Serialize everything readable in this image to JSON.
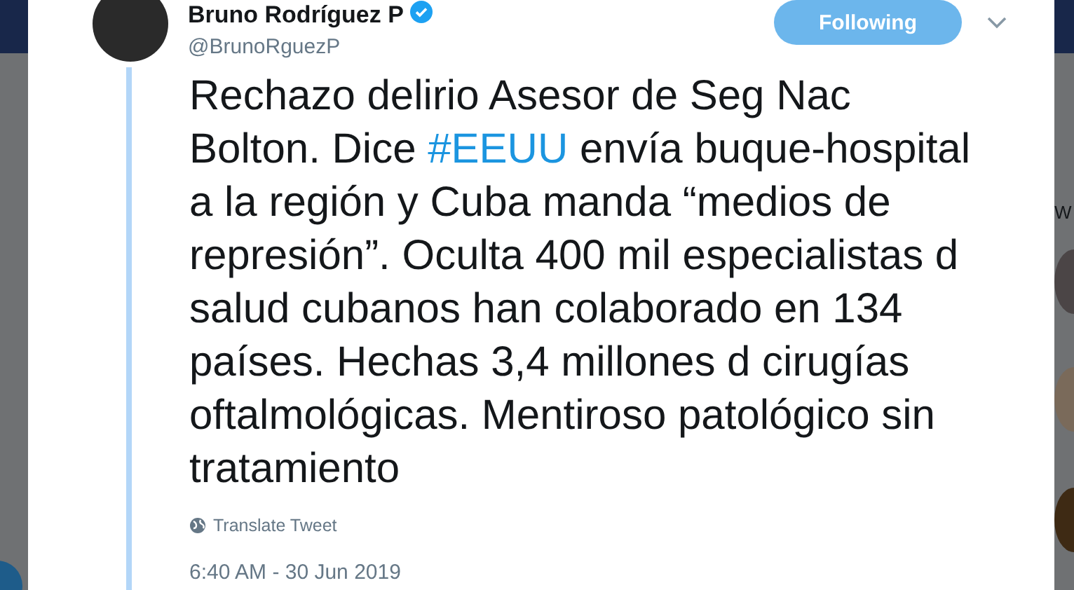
{
  "tweet": {
    "author_name": "Bruno Rodríguez P",
    "verified": true,
    "handle": "@BrunoRguezP",
    "follow_button": {
      "label": "Following",
      "selected": true
    },
    "text": [
      {
        "kind": "text",
        "value": "Rechazo delirio Asesor de Seg Nac Bolton. Dice "
      },
      {
        "kind": "hashtag",
        "value": "#EEUU"
      },
      {
        "kind": "text",
        "value": " envía buque-hospital a la región y Cuba manda “medios de represión”. Oculta 400 mil especialistas d salud cubanos han colaborado en 134 países. Hechas 3,4 millones d cirugías oftalmológicas. Mentiroso patológico sin tratamiento"
      }
    ],
    "translate_link": "Translate Tweet",
    "timestamp": "6:40 AM - 30 Jun 2019"
  },
  "sidebar": {
    "heading_fragment": "W"
  }
}
